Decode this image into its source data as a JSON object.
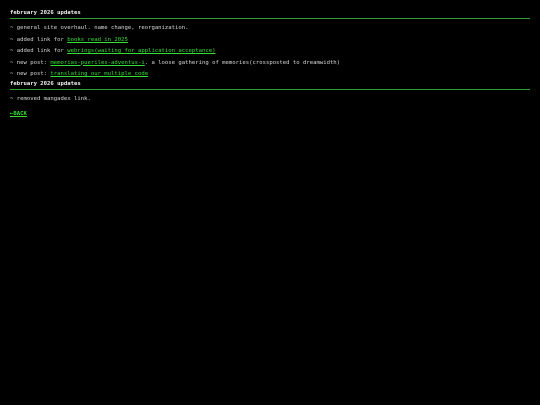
{
  "sections": [
    {
      "title": "february 2026 updates",
      "items": [
        {
          "bullet": "~",
          "before": " general site overhaul. name change, reorganization.",
          "link": "",
          "after": ""
        },
        {
          "bullet": "~",
          "before": " added link for ",
          "link": "books read in 2025",
          "after": ""
        },
        {
          "bullet": "~",
          "before": " added link for ",
          "link": "webrings(waiting for application acceptance)",
          "after": ""
        },
        {
          "bullet": "~",
          "before": " new post: ",
          "link": "memorias-pueriles-adventus-i",
          "after": ". a loose gathering of memories(crossposted to dreamwidth)"
        },
        {
          "bullet": "~",
          "before": " new post: ",
          "link": "translating our multiple code",
          "after": ""
        }
      ]
    },
    {
      "title": "february 2026 updates",
      "items": [
        {
          "bullet": "~",
          "before": " removed mangadex link.",
          "link": "",
          "after": ""
        }
      ]
    }
  ],
  "back_link": "←BACK",
  "colors": {
    "background": "#000000",
    "text": "#d8d8d8",
    "link": "#33e033",
    "rule": "#2e9b2e"
  }
}
